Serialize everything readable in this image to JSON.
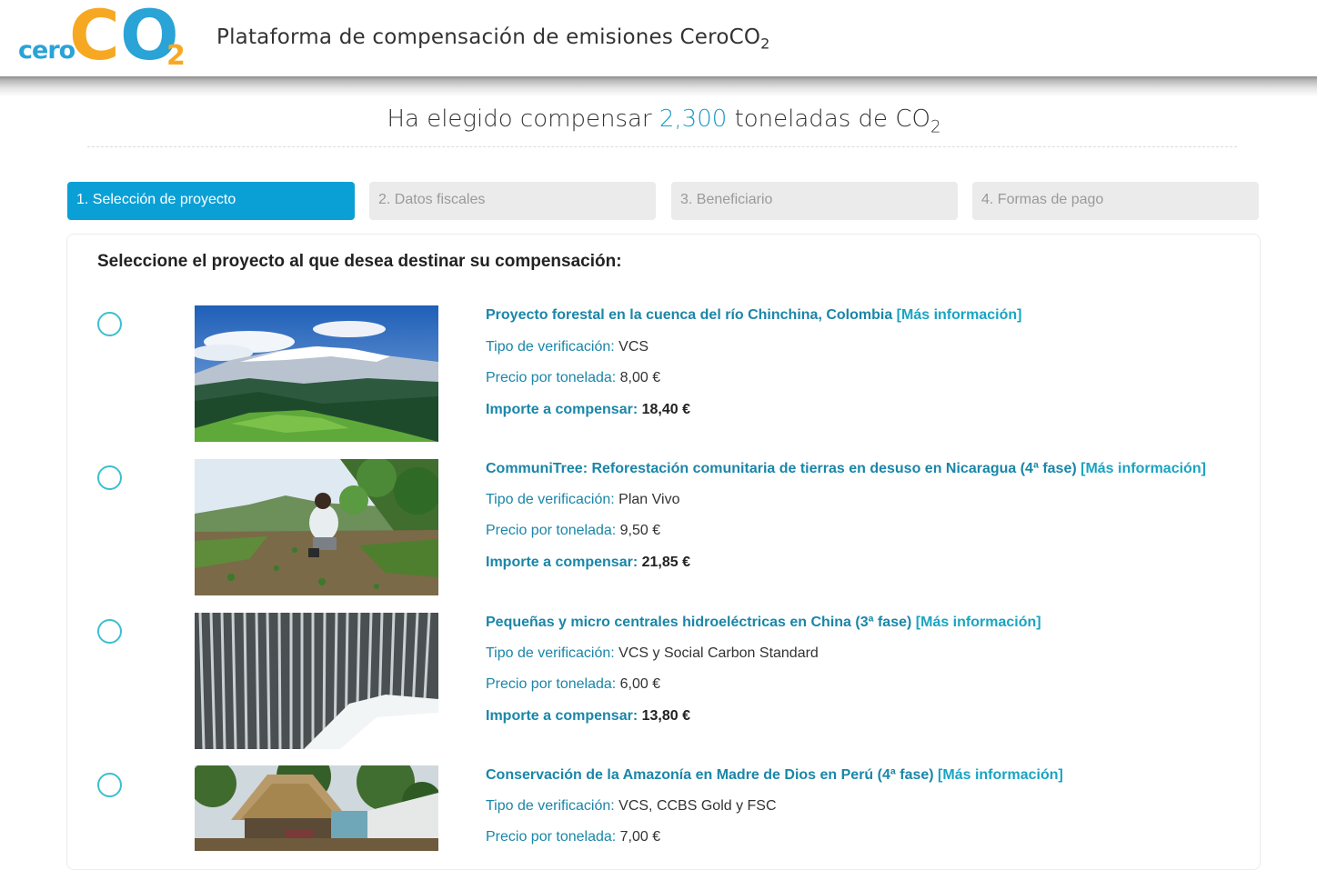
{
  "header": {
    "logo": {
      "part1": "cero",
      "part2": "C",
      "part3": "O",
      "part4": "2"
    },
    "title": "Plataforma de compensación de emisiones CeroCO",
    "title_sub": "2"
  },
  "headline": {
    "prefix": "Ha elegido compensar ",
    "amount": "2,300",
    "suffix": " toneladas de CO",
    "sub": "2"
  },
  "steps": [
    {
      "label": "1. Selección de proyecto",
      "active": true
    },
    {
      "label": "2. Datos fiscales",
      "active": false
    },
    {
      "label": "3. Beneficiario",
      "active": false
    },
    {
      "label": "4. Formas de pago",
      "active": false
    }
  ],
  "panel": {
    "title": "Seleccione el proyecto al que desea destinar su compensación:"
  },
  "labels": {
    "verification": "Tipo de verificación:",
    "price": "Precio por tonelada:",
    "amount": "Importe a compensar:",
    "more_info": "[Más información]"
  },
  "projects": [
    {
      "title": "Proyecto forestal en la cuenca del río Chinchina, Colombia",
      "verification": "VCS",
      "price": "8,00 €",
      "amount": "18,40 €",
      "image": "mountain-landscape"
    },
    {
      "title": "CommuniTree: Reforestación comunitaria de tierras en desuso en Nicaragua (4ª fase)",
      "verification": "Plan Vivo",
      "price": "9,50 €",
      "amount": "21,85 €",
      "image": "farmer-planting"
    },
    {
      "title": "Pequeñas y micro centrales hidroeléctricas en China (3ª fase)",
      "verification": "VCS y Social Carbon Standard",
      "price": "6,00 €",
      "amount": "13,80 €",
      "image": "waterfall"
    },
    {
      "title": "Conservación de la Amazonía en Madre de Dios en Perú (4ª fase)",
      "verification": "VCS, CCBS Gold y FSC",
      "price": "7,00 €",
      "amount": "",
      "image": "jungle-hut"
    }
  ],
  "colors": {
    "accent": "#0aa0d6",
    "link": "#1a86a8",
    "logo_orange": "#f7a823",
    "logo_blue": "#2aa3d6"
  }
}
